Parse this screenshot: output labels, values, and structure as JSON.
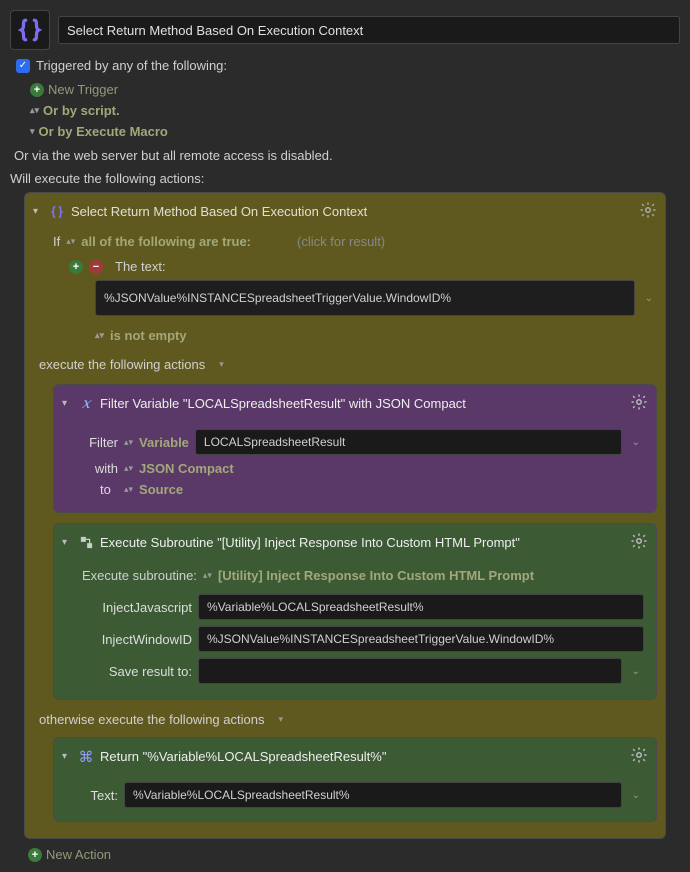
{
  "header": {
    "title": "Select Return Method Based On Execution Context"
  },
  "trigger_checkbox_label": "Triggered by any of the following:",
  "triggers": {
    "new_trigger": "New Trigger",
    "by_script": "Or by script.",
    "by_execute_macro": "Or by Execute Macro",
    "web_server_line": "Or via the web server but all remote access is disabled."
  },
  "execute_label": "Will execute the following actions:",
  "outer": {
    "title": "Select Return Method Based On Execution Context",
    "if_label": "If",
    "if_cond_selector": "all of the following are true:",
    "click_for_result": "(click for result)",
    "the_text_label": "The text:",
    "text_value": "%JSONValue%INSTANCESpreadsheetTriggerValue.WindowID%",
    "not_empty_selector": "is not empty",
    "execute_sub_label": "execute the following actions",
    "otherwise_label": "otherwise execute the following actions"
  },
  "filter_action": {
    "title": "Filter Variable \"LOCALSpreadsheetResult\" with JSON Compact",
    "filter_label": "Filter",
    "filter_type": "Variable",
    "variable_name": "LOCALSpreadsheetResult",
    "with_label": "with",
    "with_value": "JSON Compact",
    "to_label": "to",
    "to_value": "Source"
  },
  "exec_subroutine": {
    "title": "Execute Subroutine \"[Utility] Inject Response Into Custom HTML Prompt\"",
    "row_label": "Execute subroutine:",
    "subroutine_name": "[Utility] Inject Response Into Custom HTML Prompt",
    "params": [
      {
        "label": "InjectJavascript",
        "value": "%Variable%LOCALSpreadsheetResult%"
      },
      {
        "label": "InjectWindowID",
        "value": "%JSONValue%INSTANCESpreadsheetTriggerValue.WindowID%"
      },
      {
        "label": "Save result to:",
        "value": ""
      }
    ]
  },
  "return_action": {
    "title": "Return \"%Variable%LOCALSpreadsheetResult%\"",
    "text_label": "Text:",
    "text_value": "%Variable%LOCALSpreadsheetResult%"
  },
  "new_action_label": "New Action"
}
